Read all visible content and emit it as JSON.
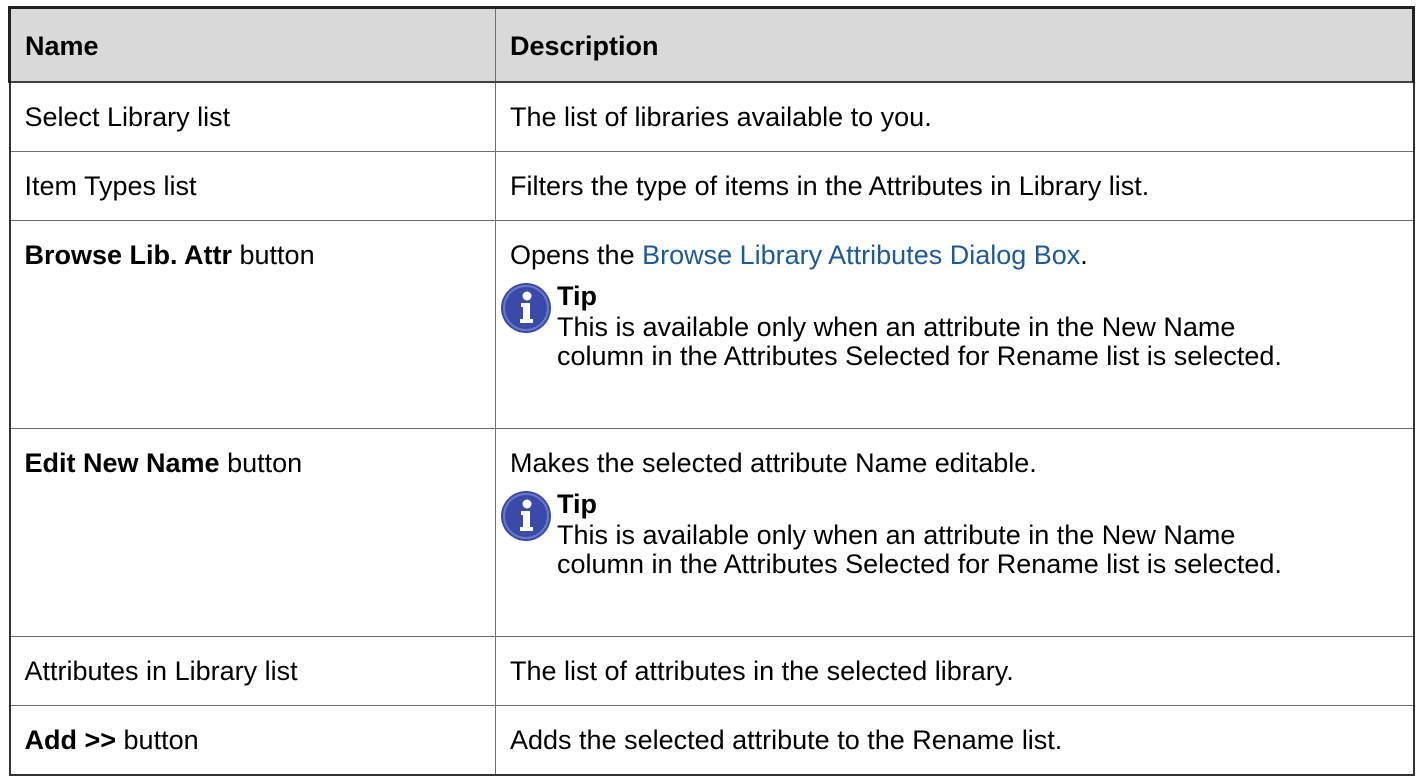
{
  "table": {
    "headers": {
      "name": "Name",
      "description": "Description"
    },
    "rows": [
      {
        "name_bold": "",
        "name_rest": "Select Library list",
        "description": "The list of libraries available to you."
      },
      {
        "name_bold": "",
        "name_rest": "Item Types list",
        "description": "Filters the type of items in the Attributes in Library list."
      },
      {
        "name_bold": "Browse Lib. Attr",
        "name_rest": " button",
        "description_before": "Opens the ",
        "description_link": "Browse Library Attributes Dialog Box",
        "description_after": ".",
        "tip": {
          "icon": "info-icon",
          "label": "Tip",
          "line1": "This is available only when an attribute in the New Name",
          "line2": "column in the Attributes Selected for Rename list is selected."
        }
      },
      {
        "name_bold": "Edit New Name",
        "name_rest": " button",
        "description": "Makes the selected attribute Name editable.",
        "tip": {
          "icon": "info-icon",
          "label": "Tip",
          "line1": "This is available only when an attribute in the New Name",
          "line2": "column in the Attributes Selected for Rename list is selected."
        }
      },
      {
        "name_bold": "",
        "name_rest": "Attributes in Library list",
        "description": "The list of attributes in the selected library."
      },
      {
        "name_bold": "Add >>",
        "name_rest": " button",
        "description": "Adds the selected attribute to the Rename list."
      }
    ]
  },
  "colors": {
    "header_background": "#d9d9d9",
    "link": "#1d5a9c",
    "tip_icon": "#3a4aa8"
  }
}
